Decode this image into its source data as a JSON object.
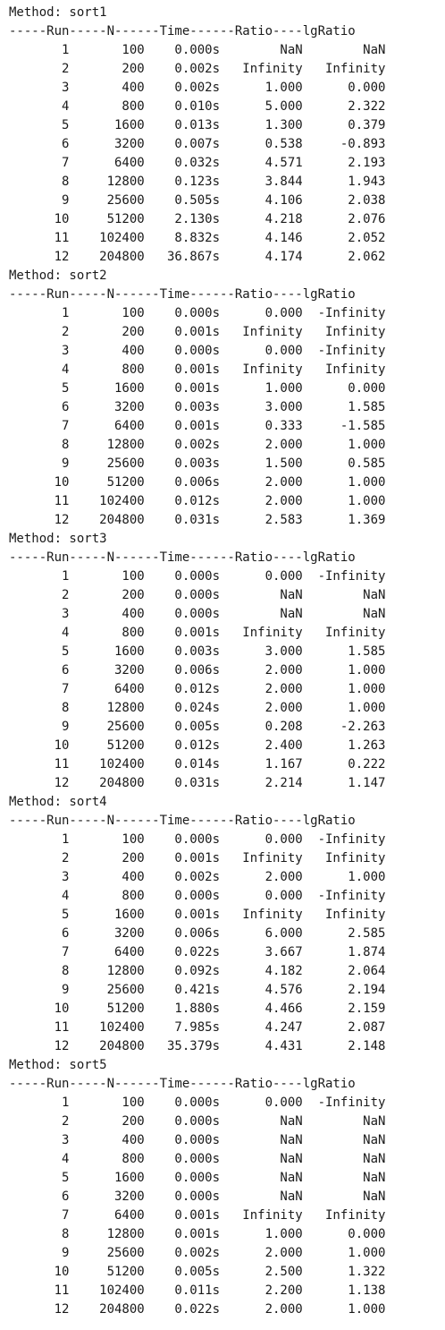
{
  "console": {
    "header_line": "-----Run-----N------Time------Ratio----lgRatio",
    "blocks": [
      {
        "method_label": "Method: sort1",
        "rows": [
          {
            "run": "1",
            "n": "100",
            "time": "0.000s",
            "ratio": "NaN",
            "lgratio": "NaN"
          },
          {
            "run": "2",
            "n": "200",
            "time": "0.002s",
            "ratio": "Infinity",
            "lgratio": "Infinity"
          },
          {
            "run": "3",
            "n": "400",
            "time": "0.002s",
            "ratio": "1.000",
            "lgratio": "0.000"
          },
          {
            "run": "4",
            "n": "800",
            "time": "0.010s",
            "ratio": "5.000",
            "lgratio": "2.322"
          },
          {
            "run": "5",
            "n": "1600",
            "time": "0.013s",
            "ratio": "1.300",
            "lgratio": "0.379"
          },
          {
            "run": "6",
            "n": "3200",
            "time": "0.007s",
            "ratio": "0.538",
            "lgratio": "-0.893"
          },
          {
            "run": "7",
            "n": "6400",
            "time": "0.032s",
            "ratio": "4.571",
            "lgratio": "2.193"
          },
          {
            "run": "8",
            "n": "12800",
            "time": "0.123s",
            "ratio": "3.844",
            "lgratio": "1.943"
          },
          {
            "run": "9",
            "n": "25600",
            "time": "0.505s",
            "ratio": "4.106",
            "lgratio": "2.038"
          },
          {
            "run": "10",
            "n": "51200",
            "time": "2.130s",
            "ratio": "4.218",
            "lgratio": "2.076"
          },
          {
            "run": "11",
            "n": "102400",
            "time": "8.832s",
            "ratio": "4.146",
            "lgratio": "2.052"
          },
          {
            "run": "12",
            "n": "204800",
            "time": "36.867s",
            "ratio": "4.174",
            "lgratio": "2.062"
          }
        ]
      },
      {
        "method_label": "Method: sort2",
        "rows": [
          {
            "run": "1",
            "n": "100",
            "time": "0.000s",
            "ratio": "0.000",
            "lgratio": "-Infinity"
          },
          {
            "run": "2",
            "n": "200",
            "time": "0.001s",
            "ratio": "Infinity",
            "lgratio": "Infinity"
          },
          {
            "run": "3",
            "n": "400",
            "time": "0.000s",
            "ratio": "0.000",
            "lgratio": "-Infinity"
          },
          {
            "run": "4",
            "n": "800",
            "time": "0.001s",
            "ratio": "Infinity",
            "lgratio": "Infinity"
          },
          {
            "run": "5",
            "n": "1600",
            "time": "0.001s",
            "ratio": "1.000",
            "lgratio": "0.000"
          },
          {
            "run": "6",
            "n": "3200",
            "time": "0.003s",
            "ratio": "3.000",
            "lgratio": "1.585"
          },
          {
            "run": "7",
            "n": "6400",
            "time": "0.001s",
            "ratio": "0.333",
            "lgratio": "-1.585"
          },
          {
            "run": "8",
            "n": "12800",
            "time": "0.002s",
            "ratio": "2.000",
            "lgratio": "1.000"
          },
          {
            "run": "9",
            "n": "25600",
            "time": "0.003s",
            "ratio": "1.500",
            "lgratio": "0.585"
          },
          {
            "run": "10",
            "n": "51200",
            "time": "0.006s",
            "ratio": "2.000",
            "lgratio": "1.000"
          },
          {
            "run": "11",
            "n": "102400",
            "time": "0.012s",
            "ratio": "2.000",
            "lgratio": "1.000"
          },
          {
            "run": "12",
            "n": "204800",
            "time": "0.031s",
            "ratio": "2.583",
            "lgratio": "1.369"
          }
        ]
      },
      {
        "method_label": "Method: sort3",
        "rows": [
          {
            "run": "1",
            "n": "100",
            "time": "0.000s",
            "ratio": "0.000",
            "lgratio": "-Infinity"
          },
          {
            "run": "2",
            "n": "200",
            "time": "0.000s",
            "ratio": "NaN",
            "lgratio": "NaN"
          },
          {
            "run": "3",
            "n": "400",
            "time": "0.000s",
            "ratio": "NaN",
            "lgratio": "NaN"
          },
          {
            "run": "4",
            "n": "800",
            "time": "0.001s",
            "ratio": "Infinity",
            "lgratio": "Infinity"
          },
          {
            "run": "5",
            "n": "1600",
            "time": "0.003s",
            "ratio": "3.000",
            "lgratio": "1.585"
          },
          {
            "run": "6",
            "n": "3200",
            "time": "0.006s",
            "ratio": "2.000",
            "lgratio": "1.000"
          },
          {
            "run": "7",
            "n": "6400",
            "time": "0.012s",
            "ratio": "2.000",
            "lgratio": "1.000"
          },
          {
            "run": "8",
            "n": "12800",
            "time": "0.024s",
            "ratio": "2.000",
            "lgratio": "1.000"
          },
          {
            "run": "9",
            "n": "25600",
            "time": "0.005s",
            "ratio": "0.208",
            "lgratio": "-2.263"
          },
          {
            "run": "10",
            "n": "51200",
            "time": "0.012s",
            "ratio": "2.400",
            "lgratio": "1.263"
          },
          {
            "run": "11",
            "n": "102400",
            "time": "0.014s",
            "ratio": "1.167",
            "lgratio": "0.222"
          },
          {
            "run": "12",
            "n": "204800",
            "time": "0.031s",
            "ratio": "2.214",
            "lgratio": "1.147"
          }
        ]
      },
      {
        "method_label": "Method: sort4",
        "rows": [
          {
            "run": "1",
            "n": "100",
            "time": "0.000s",
            "ratio": "0.000",
            "lgratio": "-Infinity"
          },
          {
            "run": "2",
            "n": "200",
            "time": "0.001s",
            "ratio": "Infinity",
            "lgratio": "Infinity"
          },
          {
            "run": "3",
            "n": "400",
            "time": "0.002s",
            "ratio": "2.000",
            "lgratio": "1.000"
          },
          {
            "run": "4",
            "n": "800",
            "time": "0.000s",
            "ratio": "0.000",
            "lgratio": "-Infinity"
          },
          {
            "run": "5",
            "n": "1600",
            "time": "0.001s",
            "ratio": "Infinity",
            "lgratio": "Infinity"
          },
          {
            "run": "6",
            "n": "3200",
            "time": "0.006s",
            "ratio": "6.000",
            "lgratio": "2.585"
          },
          {
            "run": "7",
            "n": "6400",
            "time": "0.022s",
            "ratio": "3.667",
            "lgratio": "1.874"
          },
          {
            "run": "8",
            "n": "12800",
            "time": "0.092s",
            "ratio": "4.182",
            "lgratio": "2.064"
          },
          {
            "run": "9",
            "n": "25600",
            "time": "0.421s",
            "ratio": "4.576",
            "lgratio": "2.194"
          },
          {
            "run": "10",
            "n": "51200",
            "time": "1.880s",
            "ratio": "4.466",
            "lgratio": "2.159"
          },
          {
            "run": "11",
            "n": "102400",
            "time": "7.985s",
            "ratio": "4.247",
            "lgratio": "2.087"
          },
          {
            "run": "12",
            "n": "204800",
            "time": "35.379s",
            "ratio": "4.431",
            "lgratio": "2.148"
          }
        ]
      },
      {
        "method_label": "Method: sort5",
        "rows": [
          {
            "run": "1",
            "n": "100",
            "time": "0.000s",
            "ratio": "0.000",
            "lgratio": "-Infinity"
          },
          {
            "run": "2",
            "n": "200",
            "time": "0.000s",
            "ratio": "NaN",
            "lgratio": "NaN"
          },
          {
            "run": "3",
            "n": "400",
            "time": "0.000s",
            "ratio": "NaN",
            "lgratio": "NaN"
          },
          {
            "run": "4",
            "n": "800",
            "time": "0.000s",
            "ratio": "NaN",
            "lgratio": "NaN"
          },
          {
            "run": "5",
            "n": "1600",
            "time": "0.000s",
            "ratio": "NaN",
            "lgratio": "NaN"
          },
          {
            "run": "6",
            "n": "3200",
            "time": "0.000s",
            "ratio": "NaN",
            "lgratio": "NaN"
          },
          {
            "run": "7",
            "n": "6400",
            "time": "0.001s",
            "ratio": "Infinity",
            "lgratio": "Infinity"
          },
          {
            "run": "8",
            "n": "12800",
            "time": "0.001s",
            "ratio": "1.000",
            "lgratio": "0.000"
          },
          {
            "run": "9",
            "n": "25600",
            "time": "0.002s",
            "ratio": "2.000",
            "lgratio": "1.000"
          },
          {
            "run": "10",
            "n": "51200",
            "time": "0.005s",
            "ratio": "2.500",
            "lgratio": "1.322"
          },
          {
            "run": "11",
            "n": "102400",
            "time": "0.011s",
            "ratio": "2.200",
            "lgratio": "1.138"
          },
          {
            "run": "12",
            "n": "204800",
            "time": "0.022s",
            "ratio": "2.000",
            "lgratio": "1.000"
          }
        ]
      }
    ]
  }
}
